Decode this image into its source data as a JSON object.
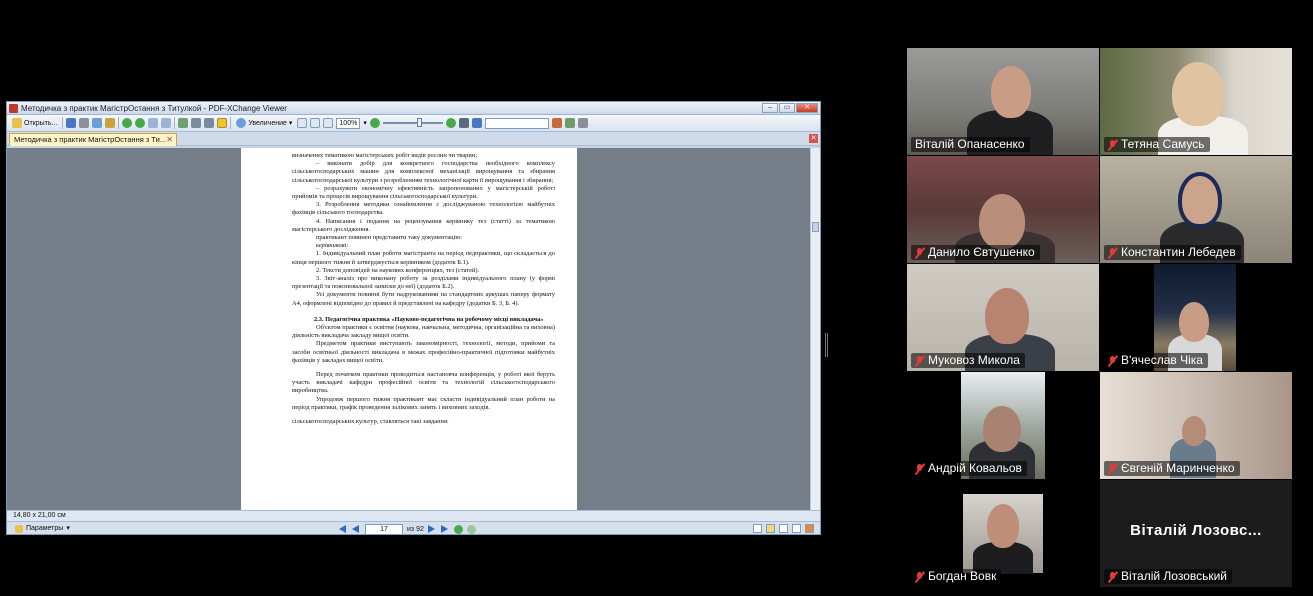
{
  "viewer": {
    "window_title": "Методичка з практик МагістрОстання з Титулкой - PDF-XChange Viewer",
    "tab_title": "Методичка з практик МагістрОстання з Ти...",
    "toolbar": {
      "open_label": "Открыть...",
      "zoom_label": "Увеличение",
      "zoom_value": "100%"
    },
    "page_size": "14,80 x 21,00 см",
    "params_label": "Параметры",
    "current_page": "17",
    "total_pages": "из 92",
    "page_text": [
      "визначених тематикою магістерських робіт видів рослин чи тварин;",
      "–      виконати добір для конкретного господарства необхідного комплексу сільськогосподарських машин для комплексної механізації вирощування та збирання сільськогосподарської культури з розробленням технологічної карти її вирощування і збирання;",
      "–      розрахувати економічну ефективність запропонованих у магістерській роботі прийомів та процесів вирощування сільськогосподарської культури.",
      "3.  Розроблення методики ознайомлення з досліджуваною технологією майбутніх фахівців сільського господарства.",
      "4. Написання і подання на рецензування керівнику тез (статті) за тематикою магістерського дослідження.",
      "практикант повинен представити таку документацію:",
      "керівникові:",
      "1.  Індивідуальний план роботи магістранта на період педпрактики, що складається до кінця першого тижня й затверджується керівником (додаток Б.1).",
      "2.  Тексти доповідей на наукових конференціях, тез (статей).",
      "3.  Звіт-аналіз про виконану роботу за розділами індивідуального плану (у формі презентації та пояснювальної записки до неї) (додаток Б.2).",
      "Усі документи повинні бути надрукованими на стандартних аркушах паперу формату А4, оформлені відповідно до правил й представлені на кафедру (додатки Б. 3, Б. 4).",
      "2.3. Педагогічна практика «Науково-педагогічна на робочому місці викладача»",
      "Об'єктом практики є освітня (наукова, навчальна, методична, організаційна та виховна) діяльність викладача закладу вищої освіти.",
      "Предметом практики виступають закономірності, технології, методи, прийоми та засоби освітньої діяльності викладача в межах професійно-практичної підготовки майбутніх фахівців у закладах вищої освіти.",
      "Перед початком практики проводиться настановча конференція, у роботі якої беруть участь викладачі кафедри професійної освіти та технологій сільськогосподарського виробництва.",
      "Упродовж першого тижня практикант має скласти індивідуальний план роботи на період практики, графік проведення залікових занять і виховних заходів.",
      "сільськогосподарських культур, ставляться такі завдання:"
    ]
  },
  "participants": [
    {
      "name": "Віталій Опанасенко",
      "muted": false,
      "active": true
    },
    {
      "name": "Тетяна Самусь",
      "muted": true,
      "active": false
    },
    {
      "name": "Данило Євтушенко",
      "muted": true,
      "active": false
    },
    {
      "name": "Константин Лебедев",
      "muted": true,
      "active": false
    },
    {
      "name": "Муковоз Микола",
      "muted": true,
      "active": false
    },
    {
      "name": "В'ячеслав Чіка",
      "muted": true,
      "active": false
    },
    {
      "name": "Андрій Ковальов",
      "muted": true,
      "active": false
    },
    {
      "name": "Євгеній Маринченко",
      "muted": true,
      "active": false
    },
    {
      "name": "Богдан Вовк",
      "muted": true,
      "active": false
    },
    {
      "name": "Віталій Лозовський",
      "muted": true,
      "active": false,
      "placeholder_name": "Віталій  Лозовс..."
    }
  ],
  "colors": {
    "active_speaker": "#23d959",
    "muted_mic": "#e23a3a",
    "doc_background": "#747d88"
  }
}
